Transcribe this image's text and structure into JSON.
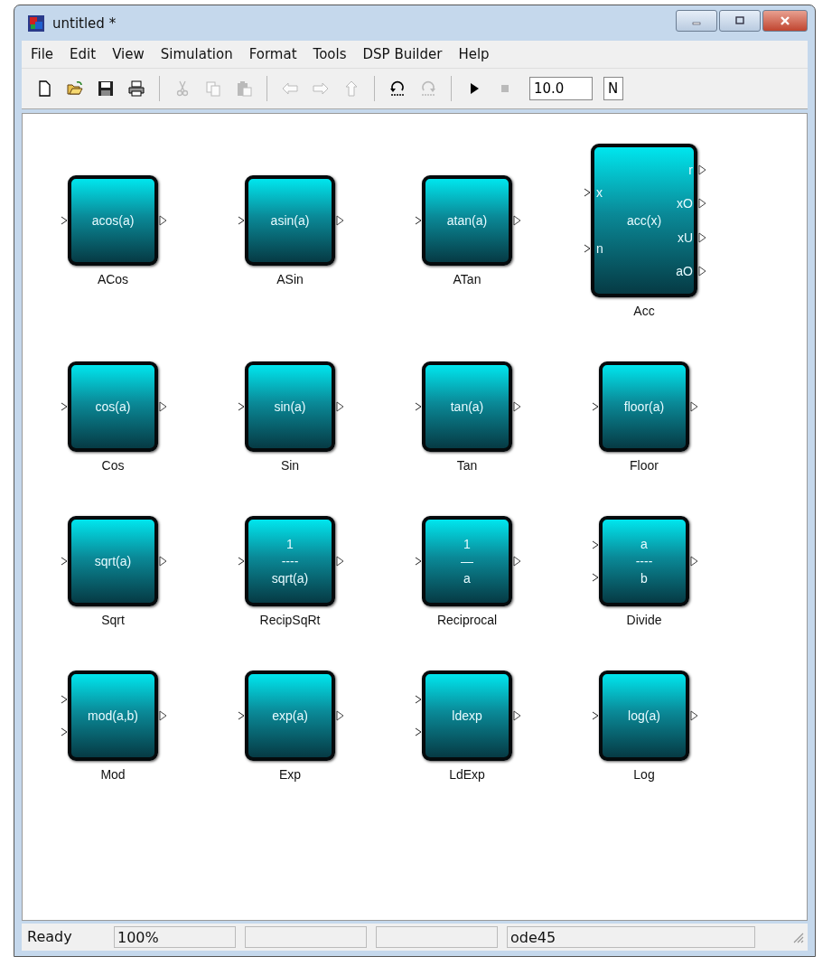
{
  "window": {
    "title": "untitled *"
  },
  "menu": [
    {
      "label": "File"
    },
    {
      "label": "Edit"
    },
    {
      "label": "View"
    },
    {
      "label": "Simulation"
    },
    {
      "label": "Format"
    },
    {
      "label": "Tools"
    },
    {
      "label": "DSP Builder"
    },
    {
      "label": "Help"
    }
  ],
  "toolbar": [
    {
      "kind": "new",
      "disabled": false
    },
    {
      "kind": "open",
      "disabled": false
    },
    {
      "kind": "save",
      "disabled": false
    },
    {
      "kind": "print",
      "disabled": false
    },
    {
      "kind": "separator"
    },
    {
      "kind": "cut",
      "disabled": true
    },
    {
      "kind": "copy",
      "disabled": true
    },
    {
      "kind": "paste",
      "disabled": true
    },
    {
      "kind": "separator"
    },
    {
      "kind": "back",
      "disabled": true
    },
    {
      "kind": "forward",
      "disabled": true
    },
    {
      "kind": "up",
      "disabled": true
    },
    {
      "kind": "separator"
    },
    {
      "kind": "undo",
      "disabled": false
    },
    {
      "kind": "redo",
      "disabled": true
    },
    {
      "kind": "separator"
    },
    {
      "kind": "play",
      "disabled": false
    },
    {
      "kind": "stop",
      "disabled": true
    },
    {
      "kind": "field",
      "value": "10.0"
    },
    {
      "kind": "field",
      "value": "N"
    }
  ],
  "blocks": [
    {
      "name": "ACos",
      "lines": [
        "acos(a)"
      ],
      "inputs": [
        {
          "kind": "plain"
        }
      ],
      "outputs": [
        {
          "kind": "plain"
        }
      ]
    },
    {
      "name": "ASin",
      "lines": [
        "asin(a)"
      ],
      "inputs": [
        {
          "kind": "plain"
        }
      ],
      "outputs": [
        {
          "kind": "plain"
        }
      ]
    },
    {
      "name": "ATan",
      "lines": [
        "atan(a)"
      ],
      "inputs": [
        {
          "kind": "plain"
        }
      ],
      "outputs": [
        {
          "kind": "plain"
        }
      ]
    },
    {
      "name": "Acc",
      "lines": [
        "acc(x)"
      ],
      "inputs": [
        {
          "kind": "labeled",
          "label": "x"
        },
        {
          "kind": "labeled",
          "label": "n"
        }
      ],
      "outputs": [
        {
          "kind": "labeled",
          "label": "r"
        },
        {
          "kind": "labeled",
          "label": "xO"
        },
        {
          "kind": "labeled",
          "label": "xU"
        },
        {
          "kind": "labeled",
          "label": "aO"
        }
      ]
    },
    {
      "name": "Cos",
      "lines": [
        "cos(a)"
      ],
      "inputs": [
        {
          "kind": "plain"
        }
      ],
      "outputs": [
        {
          "kind": "plain"
        }
      ]
    },
    {
      "name": "Sin",
      "lines": [
        "sin(a)"
      ],
      "inputs": [
        {
          "kind": "plain"
        }
      ],
      "outputs": [
        {
          "kind": "plain"
        }
      ]
    },
    {
      "name": "Tan",
      "lines": [
        "tan(a)"
      ],
      "inputs": [
        {
          "kind": "plain"
        }
      ],
      "outputs": [
        {
          "kind": "plain"
        }
      ]
    },
    {
      "name": "Floor",
      "lines": [
        "floor(a)"
      ],
      "inputs": [
        {
          "kind": "plain"
        }
      ],
      "outputs": [
        {
          "kind": "plain"
        }
      ]
    },
    {
      "name": "Sqrt",
      "lines": [
        "sqrt(a)"
      ],
      "inputs": [
        {
          "kind": "plain"
        }
      ],
      "outputs": [
        {
          "kind": "plain"
        }
      ]
    },
    {
      "name": "RecipSqRt",
      "lines": [
        "1",
        "----",
        "sqrt(a)"
      ],
      "inputs": [
        {
          "kind": "plain"
        }
      ],
      "outputs": [
        {
          "kind": "plain"
        }
      ]
    },
    {
      "name": "Reciprocal",
      "lines": [
        "1",
        "—",
        "a"
      ],
      "inputs": [
        {
          "kind": "plain"
        }
      ],
      "outputs": [
        {
          "kind": "plain"
        }
      ]
    },
    {
      "name": "Divide",
      "lines": [
        "a",
        "----",
        "b"
      ],
      "inputs": [
        {
          "kind": "plain"
        },
        {
          "kind": "plain"
        }
      ],
      "outputs": [
        {
          "kind": "plain"
        }
      ]
    },
    {
      "name": "Mod",
      "lines": [
        "mod(a,b)"
      ],
      "inputs": [
        {
          "kind": "plain"
        },
        {
          "kind": "plain"
        }
      ],
      "outputs": [
        {
          "kind": "plain"
        }
      ]
    },
    {
      "name": "Exp",
      "lines": [
        "exp(a)"
      ],
      "inputs": [
        {
          "kind": "plain"
        }
      ],
      "outputs": [
        {
          "kind": "plain"
        }
      ]
    },
    {
      "name": "LdExp",
      "lines": [
        "ldexp"
      ],
      "inputs": [
        {
          "kind": "plain"
        },
        {
          "kind": "plain"
        }
      ],
      "outputs": [
        {
          "kind": "plain"
        }
      ]
    },
    {
      "name": "Log",
      "lines": [
        "log(a)"
      ],
      "inputs": [
        {
          "kind": "plain"
        }
      ],
      "outputs": [
        {
          "kind": "plain"
        }
      ]
    }
  ],
  "status_bar": [
    {
      "text": "Ready",
      "kind": "plain"
    },
    {
      "text": "100%",
      "kind": "pane"
    },
    {
      "kind": "pane"
    },
    {
      "kind": "pane"
    },
    {
      "text": "ode45",
      "kind": "pane"
    }
  ]
}
